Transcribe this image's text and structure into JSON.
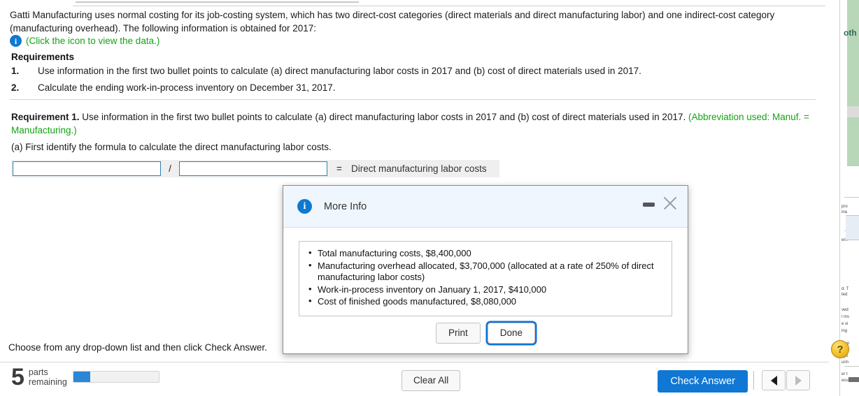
{
  "question": {
    "prompt": "Gatti Manufacturing uses normal costing for its job-costing system, which has two direct-cost categories (direct materials and direct manufacturing labor) and one indirect-cost category (manufacturing overhead). The following information is obtained for 2017:",
    "data_link_label": "(Click the icon to view the data.)",
    "info_icon": "info-icon",
    "requirements_heading": "Requirements",
    "requirements": [
      {
        "num": "1.",
        "text": "Use information in the first two bullet points to calculate (a) direct manufacturing labor costs in 2017 and (b) cost of direct materials used in 2017."
      },
      {
        "num": "2.",
        "text": "Calculate the ending work-in-process inventory on December 31, 2017."
      }
    ]
  },
  "requirement1": {
    "label": "Requirement 1.",
    "text": " Use information in the first two bullet points to calculate (a) direct manufacturing labor costs in 2017 and (b) cost of direct materials used in 2017. ",
    "abbreviation_note": "(Abbreviation used: Manuf. = Manufacturing.)",
    "sub_a": "(a) First identify the formula to calculate the direct manufacturing labor costs."
  },
  "formula": {
    "numerator_value": "",
    "numerator_placeholder": "",
    "divider": "/",
    "denominator_value": "",
    "denominator_placeholder": "",
    "equals": "=",
    "result_label": "Direct manufacturing labor costs"
  },
  "modal": {
    "title": "More Info",
    "info_icon": "info-icon",
    "minimize_icon": "minimize-icon",
    "close_icon": "close-icon",
    "bullets": [
      "Total manufacturing costs, $8,400,000",
      "Manufacturing overhead allocated, $3,700,000 (allocated at a rate of 250% of direct manufacturing labor costs)",
      "Work-in-process inventory on January 1, 2017, $410,000",
      "Cost of finished goods manufactured, $8,080,000"
    ],
    "print_label": "Print",
    "done_label": "Done"
  },
  "footer": {
    "hint": "Choose from any drop-down list and then click Check Answer.",
    "parts_number": "5",
    "parts_label_line1": "parts",
    "parts_label_line2": "remaining",
    "progress_percent": 20,
    "clear_all_label": "Clear All",
    "check_answer_label": "Check Answer",
    "prev_icon": "triangle-left-icon",
    "next_icon": "triangle-right-icon",
    "help_label": "?"
  },
  "right_panel": {
    "title_fragment": "oth",
    "text_fragments": [
      "pro",
      "ina",
      "erh",
      "d. T",
      "ted",
      "ved",
      "l ms",
      "e vi",
      "ing",
      "d vo",
      "hes",
      "eys",
      "urin",
      "er t",
      "ecu"
    ]
  },
  "colors": {
    "accent_blue": "#1177d4",
    "link_green": "#13a313",
    "info_blue": "#0f79d0",
    "help_yellow": "#f2c029",
    "modal_header": "#f0f6fd"
  }
}
